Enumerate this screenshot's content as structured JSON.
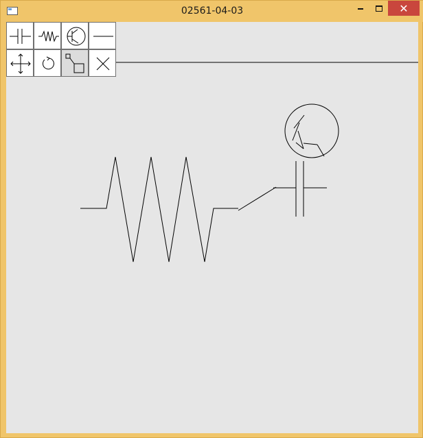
{
  "window": {
    "title": "02561-04-03",
    "minimize_glyph": "",
    "close_glyph": "✕"
  },
  "toolbar": {
    "tools": [
      {
        "name": "capacitor-tool",
        "icon": "capacitor-icon"
      },
      {
        "name": "resistor-tool",
        "icon": "resistor-icon"
      },
      {
        "name": "transistor-tool",
        "icon": "transistor-icon"
      },
      {
        "name": "wire-tool",
        "icon": "line-icon"
      },
      {
        "name": "move-tool",
        "icon": "move-arrows-icon"
      },
      {
        "name": "rotate-tool",
        "icon": "rotate-icon"
      },
      {
        "name": "connect-tool",
        "icon": "connect-icon",
        "active": true
      },
      {
        "name": "delete-tool",
        "icon": "delete-x-icon"
      }
    ]
  },
  "colors": {
    "frame": "#f0c56a",
    "close_button": "#c9463d",
    "canvas_bg": "#e6e6e6",
    "stroke": "#000000"
  }
}
